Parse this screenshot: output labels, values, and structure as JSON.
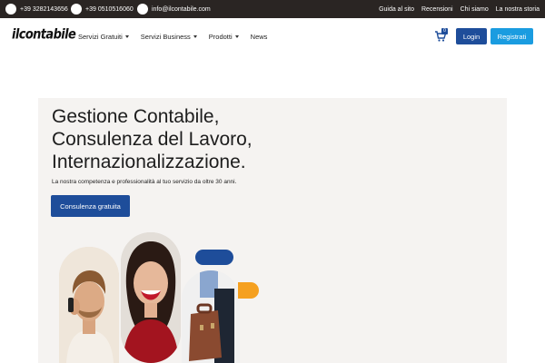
{
  "topbar": {
    "phone1": "+39 3282143656",
    "phone2": "+39 0510516060",
    "email": "info@ilcontabile.com",
    "links": [
      "Guida al sito",
      "Recensioni",
      "Chi siamo",
      "La nostra storia"
    ]
  },
  "nav": {
    "logo": "ilcontabile",
    "items": [
      {
        "label": "Servizi Gratuiti"
      },
      {
        "label": "Servizi Business"
      },
      {
        "label": "Prodotti"
      },
      {
        "label": "News"
      }
    ],
    "cart_count": "0",
    "login_label": "Login",
    "signup_label": "Registrati"
  },
  "hero": {
    "title_lines": [
      "Gestione Contabile,",
      "Consulenza del Lavoro,",
      "Internazionalizzazione."
    ],
    "subtitle": "La nostra competenza e professionalità al tuo servizio da oltre 30 anni.",
    "cta_label": "Consulenza gratuita"
  },
  "colors": {
    "topbar_bg": "#2a2523",
    "primary": "#1e4d9a",
    "accent_blue": "#1a9ce0",
    "accent_orange": "#f5a020",
    "hero_bg": "#f5f3f1"
  }
}
